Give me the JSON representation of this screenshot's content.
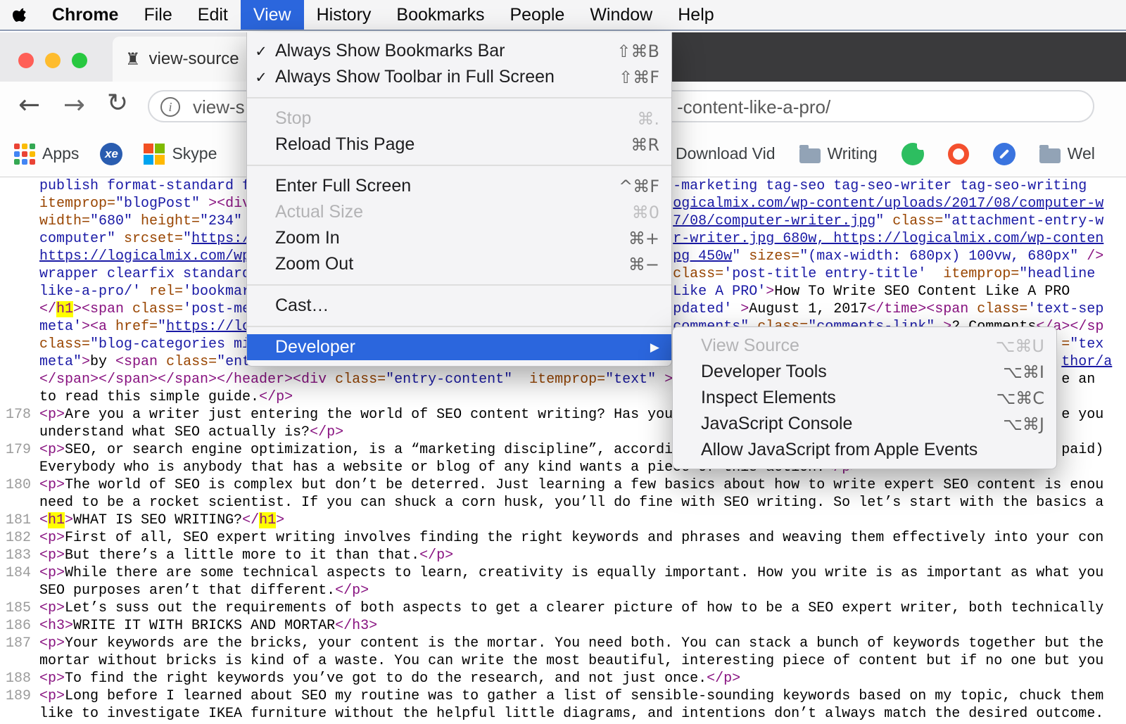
{
  "colors": {
    "accent_blue": "#2b66dd",
    "find_highlight": "#ffff00",
    "tag": "#881280",
    "attr_name": "#994500",
    "attr_value": "#1a1aa6",
    "link": "#1a1aa6",
    "tabstrip_dark": "#3a3a3c",
    "traffic_red": "#ff5f57",
    "traffic_yellow": "#febc2e",
    "traffic_green": "#28c840"
  },
  "icons": {
    "back": "←",
    "forward": "→",
    "reload": "↻",
    "info": "i",
    "tab_favicon": "♜"
  },
  "menubar": {
    "active_item": "View",
    "items": [
      {
        "id": "apple",
        "icon": "apple-logo"
      },
      {
        "id": "chrome",
        "label": "Chrome",
        "bold": true
      },
      {
        "id": "file",
        "label": "File"
      },
      {
        "id": "edit",
        "label": "Edit"
      },
      {
        "id": "view",
        "label": "View",
        "active": true
      },
      {
        "id": "history",
        "label": "History"
      },
      {
        "id": "bookmarks",
        "label": "Bookmarks"
      },
      {
        "id": "people",
        "label": "People"
      },
      {
        "id": "window",
        "label": "Window"
      },
      {
        "id": "help",
        "label": "Help"
      }
    ]
  },
  "view_menu": {
    "check_glyph": "✓",
    "submenu_arrow_glyph": "▶",
    "items": [
      {
        "label": "Always Show Bookmarks Bar",
        "shortcut": "⇧⌘B",
        "checked": true
      },
      {
        "label": "Always Show Toolbar in Full Screen",
        "shortcut": "⇧⌘F",
        "checked": true
      },
      {
        "separator": true
      },
      {
        "label": "Stop",
        "shortcut": "⌘.",
        "disabled": true
      },
      {
        "label": "Reload This Page",
        "shortcut": "⌘R"
      },
      {
        "separator": true
      },
      {
        "label": "Enter Full Screen",
        "shortcut": "^⌘F"
      },
      {
        "label": "Actual Size",
        "shortcut": "⌘0",
        "disabled": true
      },
      {
        "label": "Zoom In",
        "shortcut": "⌘+"
      },
      {
        "label": "Zoom Out",
        "shortcut": "⌘−"
      },
      {
        "separator": true
      },
      {
        "label": "Cast…"
      },
      {
        "separator": true
      },
      {
        "label": "Developer",
        "highlighted": true,
        "has_submenu": true
      }
    ]
  },
  "developer_submenu": {
    "items": [
      {
        "label": "View Source",
        "shortcut": "⌥⌘U",
        "disabled": true
      },
      {
        "label": "Developer Tools",
        "shortcut": "⌥⌘I"
      },
      {
        "label": "Inspect Elements",
        "shortcut": "⌥⌘C"
      },
      {
        "label": "JavaScript Console",
        "shortcut": "⌥⌘J"
      },
      {
        "label": "Allow JavaScript from Apple Events"
      }
    ]
  },
  "tab": {
    "title": "view-source"
  },
  "address_bar": {
    "visible_prefix": "view-s",
    "visible_suffix": "-content-like-a-pro/"
  },
  "bookmarks_bar": {
    "left_items": [
      {
        "label": "Apps",
        "icon": "apps-grid"
      },
      {
        "icon": "xe",
        "icon_text": "xe"
      },
      {
        "label": "Skype",
        "icon": "skype"
      }
    ],
    "right_items": [
      {
        "label": "Download Vid"
      },
      {
        "label": "Writing",
        "icon": "folder"
      },
      {
        "icon": "evernote"
      },
      {
        "icon": "red-ring"
      },
      {
        "icon": "pencil"
      },
      {
        "label": "Wel",
        "icon": "folder"
      }
    ]
  },
  "source_view": {
    "rows": [
      {
        "n": "",
        "s": [
          [
            "val",
            "publish format-standard f"
          ],
          [
            "val",
            "-marketing tag-seo tag-seo-writer tag-seo-writing",
            75
          ]
        ]
      },
      {
        "n": "",
        "s": [
          [
            "attr",
            "itemprop="
          ],
          [
            "val",
            "\"blogPost\""
          ],
          [
            "tag",
            " ><div"
          ],
          [
            "link",
            "ogicalmix.com/wp-content/uploads/2017/08/computer-w",
            75
          ]
        ]
      },
      {
        "n": "",
        "s": [
          [
            "attr",
            "width="
          ],
          [
            "val",
            "\"680\""
          ],
          [
            "attr",
            " height="
          ],
          [
            "val",
            "\"234\""
          ],
          [
            "link",
            "7/08/computer-writer.jpg",
            75
          ],
          [
            "val",
            "\""
          ],
          [
            "attr",
            " class="
          ],
          [
            "val",
            "\"attachment-entry-w"
          ]
        ]
      },
      {
        "n": "",
        "s": [
          [
            "val",
            "computer\""
          ],
          [
            "attr",
            " srcset="
          ],
          [
            "val",
            "\""
          ],
          [
            "link",
            "https:/"
          ],
          [
            "link",
            "r-writer.jpg 680w, https://logicalmix.com/wp-conten",
            75
          ]
        ]
      },
      {
        "n": "",
        "s": [
          [
            "link",
            "https://logicalmix.com/wp"
          ],
          [
            "link",
            "pg 450w",
            75
          ],
          [
            "val",
            "\""
          ],
          [
            "attr",
            " sizes="
          ],
          [
            "val",
            "\"(max-width: 680px) 100vw, 680px\""
          ],
          [
            "tag",
            " />"
          ]
        ]
      },
      {
        "n": "",
        "s": [
          [
            "val",
            "wrapper clearfix standard"
          ],
          [
            "attr",
            "class=",
            75
          ],
          [
            "val",
            "'post-title entry-title'"
          ],
          [
            "attr",
            "  itemprop="
          ],
          [
            "val",
            "\"headline"
          ]
        ]
      },
      {
        "n": "",
        "s": [
          [
            "val",
            "like-a-pro/'"
          ],
          [
            "attr",
            " rel="
          ],
          [
            "val",
            "'bookmar"
          ],
          [
            "val",
            "Like A PRO'",
            75
          ],
          [
            "tag",
            ">"
          ],
          [
            "text",
            "How To Write SEO Content Like A PRO"
          ]
        ]
      },
      {
        "n": "",
        "s": [
          [
            "tag",
            "</"
          ],
          [
            "hl",
            "h1"
          ],
          [
            "tag",
            "><span"
          ],
          [
            "attr",
            " class="
          ],
          [
            "val",
            "'post-me"
          ],
          [
            "val",
            "pdated'",
            75
          ],
          [
            "tag",
            " >"
          ],
          [
            "text",
            "August 1, 2017"
          ],
          [
            "tag",
            "</time><span"
          ],
          [
            "attr",
            " class="
          ],
          [
            "val",
            "'text-sep"
          ]
        ]
      },
      {
        "n": "",
        "s": [
          [
            "val",
            "meta'"
          ],
          [
            "tag",
            "><a"
          ],
          [
            "attr",
            " href="
          ],
          [
            "val",
            "\""
          ],
          [
            "link",
            "https://lo"
          ],
          [
            "link",
            "comments",
            75
          ],
          [
            "val",
            "\""
          ],
          [
            "attr",
            " class="
          ],
          [
            "val",
            "\"comments-link\""
          ],
          [
            "tag",
            " >"
          ],
          [
            "text",
            "2 Comments"
          ],
          [
            "tag",
            "</a></sp"
          ]
        ]
      },
      {
        "n": "",
        "s": [
          [
            "attr",
            "class="
          ],
          [
            "val",
            "\"blog-categories mi"
          ],
          [
            "attr",
            "=",
            121
          ],
          [
            "val",
            "\"tex"
          ]
        ]
      },
      {
        "n": "",
        "s": [
          [
            "val",
            "meta\""
          ],
          [
            "tag",
            ">"
          ],
          [
            "text",
            "by "
          ],
          [
            "tag",
            "<span"
          ],
          [
            "attr",
            " class="
          ],
          [
            "val",
            "\"ent"
          ],
          [
            "link",
            "thor/a",
            121
          ]
        ]
      },
      {
        "n": "",
        "s": [
          [
            "tag",
            "</span></span></span></header><div"
          ],
          [
            "attr",
            " class="
          ],
          [
            "val",
            "\"entry-content\""
          ],
          [
            "attr",
            "  itemprop="
          ],
          [
            "val",
            "\"text\""
          ],
          [
            "tag",
            " >"
          ],
          [
            "text",
            "e an",
            121
          ]
        ]
      },
      {
        "n": "",
        "s": [
          [
            "text",
            "to read this simple guide."
          ],
          [
            "tag",
            "</p>"
          ]
        ]
      },
      {
        "n": "178",
        "s": [
          [
            "tag",
            "<p>"
          ],
          [
            "text",
            "Are you a writer just entering the world of SEO content writing? Has you"
          ],
          [
            "text",
            "e you",
            121
          ]
        ]
      },
      {
        "n": "",
        "s": [
          [
            "text",
            "understand what SEO actually is?"
          ],
          [
            "tag",
            "</p>"
          ]
        ]
      },
      {
        "n": "179",
        "s": [
          [
            "tag",
            "<p>"
          ],
          [
            "text",
            "SEO, or search engine optimization, is a “marketing discipline”, accordi"
          ],
          [
            "text",
            "paid)",
            121
          ]
        ]
      },
      {
        "n": "",
        "s": [
          [
            "text",
            "Everybody who is anybody that has a website or blog of any kind wants a piece of this action."
          ],
          [
            "tag",
            "</p>"
          ]
        ]
      },
      {
        "n": "180",
        "s": [
          [
            "tag",
            "<p>"
          ],
          [
            "text",
            "The world of SEO is complex but don’t be deterred. Just learning a few basics about how to write expert SEO content is enou"
          ]
        ]
      },
      {
        "n": "",
        "s": [
          [
            "text",
            "need to be a rocket scientist. If you can shuck a corn husk, you’ll do fine with SEO writing. So let’s start with the basics a"
          ]
        ]
      },
      {
        "n": "181",
        "s": [
          [
            "tag",
            "<"
          ],
          [
            "hl",
            "h1"
          ],
          [
            "tag",
            ">"
          ],
          [
            "text",
            "WHAT IS SEO WRITING?"
          ],
          [
            "tag",
            "</"
          ],
          [
            "hl",
            "h1"
          ],
          [
            "tag",
            ">"
          ]
        ]
      },
      {
        "n": "182",
        "s": [
          [
            "tag",
            "<p>"
          ],
          [
            "text",
            "First of all, SEO expert writing involves finding the right keywords and phrases and weaving them effectively into your con"
          ]
        ]
      },
      {
        "n": "183",
        "s": [
          [
            "tag",
            "<p>"
          ],
          [
            "text",
            "But there’s a little more to it than that."
          ],
          [
            "tag",
            "</p>"
          ]
        ]
      },
      {
        "n": "184",
        "s": [
          [
            "tag",
            "<p>"
          ],
          [
            "text",
            "While there are some technical aspects to learn, creativity is equally important. How you write is as important as what you"
          ]
        ]
      },
      {
        "n": "",
        "s": [
          [
            "text",
            "SEO purposes aren’t that different."
          ],
          [
            "tag",
            "</p>"
          ]
        ]
      },
      {
        "n": "185",
        "s": [
          [
            "tag",
            "<p>"
          ],
          [
            "text",
            "Let’s suss out the requirements of both aspects to get a clearer picture of how to be a SEO expert writer, both technically"
          ]
        ]
      },
      {
        "n": "186",
        "s": [
          [
            "tag",
            "<h3>"
          ],
          [
            "text",
            "WRITE IT WITH BRICKS AND MORTAR"
          ],
          [
            "tag",
            "</h3>"
          ]
        ]
      },
      {
        "n": "187",
        "s": [
          [
            "tag",
            "<p>"
          ],
          [
            "text",
            "Your keywords are the bricks, your content is the mortar. You need both. You can stack a bunch of keywords together but the"
          ]
        ]
      },
      {
        "n": "",
        "s": [
          [
            "text",
            "mortar without bricks is kind of a waste. You can write the most beautiful, interesting piece of content but if no one but you"
          ]
        ]
      },
      {
        "n": "188",
        "s": [
          [
            "tag",
            "<p>"
          ],
          [
            "text",
            "To find the right keywords you’ve got to do the research, and not just once."
          ],
          [
            "tag",
            "</p>"
          ]
        ]
      },
      {
        "n": "189",
        "s": [
          [
            "tag",
            "<p>"
          ],
          [
            "text",
            "Long before I learned about SEO my routine was to gather a list of sensible-sounding keywords based on my topic, chuck them"
          ]
        ]
      },
      {
        "n": "",
        "s": [
          [
            "text",
            "like to investigate IKEA furniture without the helpful little diagrams, and intentions don’t always match the desired outcome."
          ]
        ]
      }
    ]
  }
}
